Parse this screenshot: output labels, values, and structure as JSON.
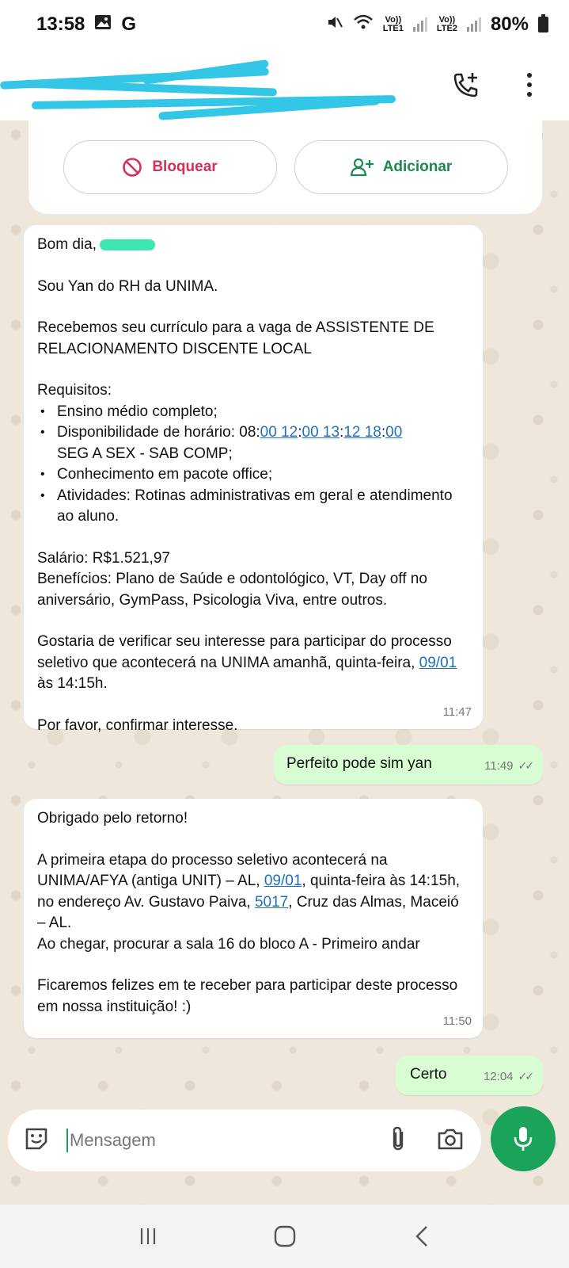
{
  "status_bar": {
    "time": "13:58",
    "carrier_icon": "G",
    "sim1_label_top": "Vo))",
    "sim1_label_bottom": "LTE1",
    "sim2_label_top": "Vo))",
    "sim2_label_bottom": "LTE2",
    "battery": "80%",
    "icons": [
      "gallery-icon",
      "mute-icon",
      "wifi-icon",
      "signal-icon",
      "battery-icon"
    ]
  },
  "header": {
    "actions": [
      "add-call-icon",
      "more-options-icon"
    ]
  },
  "contact_card": {
    "block_label": "Bloquear",
    "add_label": "Adicionar"
  },
  "messages": [
    {
      "direction": "in",
      "greeting": "Bom dia,",
      "line_intro": "Sou Yan do RH da UNIMA.",
      "line_vaga": "Recebemos seu currículo para a vaga de ASSISTENTE DE RELACIONAMENTO DISCENTE LOCAL",
      "req_title": "Requisitos:",
      "req_1": "Ensino médio completo;",
      "req_2_prefix": "Disponibilidade de horário: 08:",
      "req_2_l1": "00 12",
      "req_2_s1": ":",
      "req_2_l2": "00 13",
      "req_2_s2": ":",
      "req_2_l3": "12 18",
      "req_2_s3": ":",
      "req_2_l4": "00",
      "req_2_suffix": "SEG A SEX - SAB COMP;",
      "req_3": "Conhecimento em pacote office;",
      "req_4": "Atividades: Rotinas administrativas em geral e atendimento ao aluno.",
      "salary": "Salário: R$1.521,97",
      "benefits": "Benefícios: Plano de Saúde e odontológico, VT, Day off no aniversário, GymPass, Psicologia Viva, entre outros.",
      "interest_pre": "Gostaria de verificar seu interesse para participar do processo seletivo que acontecerá na UNIMA amanhã, quinta-feira, ",
      "interest_link": "09/01",
      "interest_post": " às 14:15h.",
      "confirm": "Por favor, confirmar interesse.",
      "time": "11:47"
    },
    {
      "direction": "out",
      "text": "Perfeito pode sim yan",
      "time": "11:49"
    },
    {
      "direction": "in",
      "thanks": "Obrigado pelo retorno!",
      "p1_a": "A primeira etapa do processo seletivo acontecerá na UNIMA/AFYA (antiga UNIT) – AL, ",
      "p1_link1": "09/01",
      "p1_b": ", quinta-feira às 14:15h, no endereço Av. Gustavo Paiva, ",
      "p1_link2": "5017",
      "p1_c": ", Cruz das Almas, Maceió – AL.",
      "p2": "Ao chegar, procurar a sala 16 do bloco A - Primeiro andar",
      "p3": "Ficaremos felizes em te receber para participar deste processo em nossa instituição! :)",
      "time": "11:50"
    },
    {
      "direction": "out",
      "text": "Certo",
      "time": "12:04"
    }
  ],
  "composer": {
    "placeholder": "Mensagem",
    "icons": [
      "emoji-icon",
      "attach-icon",
      "camera-icon",
      "mic-icon"
    ]
  },
  "nav": {
    "icons": [
      "recent-apps-icon",
      "home-icon",
      "back-icon"
    ]
  },
  "colors": {
    "outgoing_bubble": "#d9fdd3",
    "accent_green": "#1aa35a",
    "block_red": "#d1315b",
    "link_blue": "#1e6fbf",
    "chat_background": "#efe7dc"
  }
}
